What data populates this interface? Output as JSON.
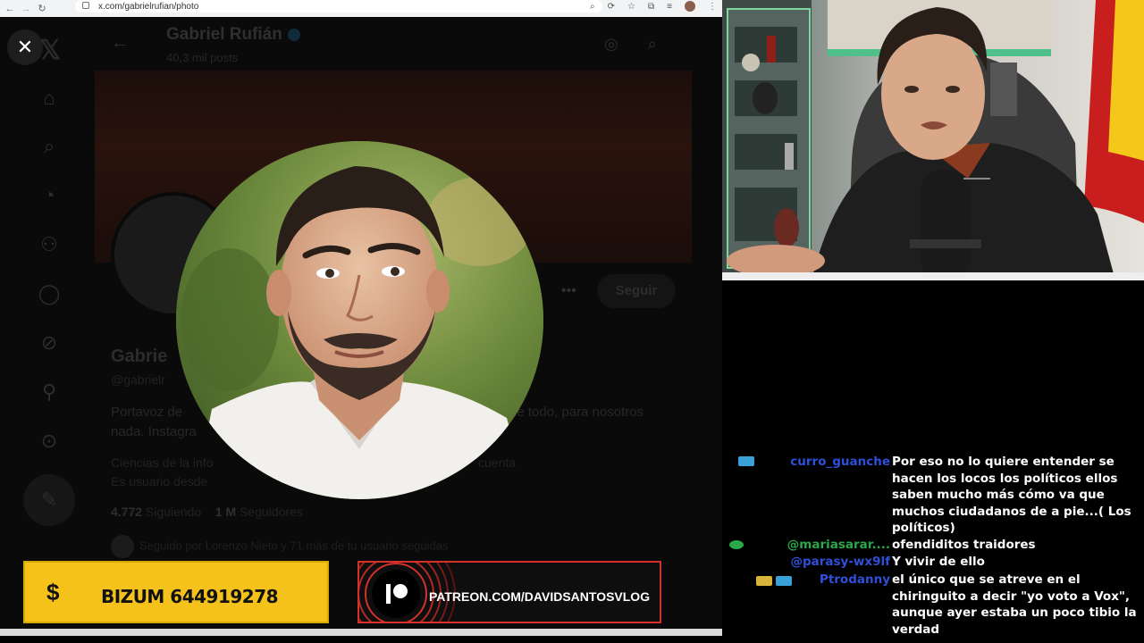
{
  "browser": {
    "url": "x.com/gabrielrufian/photo"
  },
  "x_profile": {
    "top_name": "Gabriel Rufián",
    "posts": "40,3 mil posts",
    "follow_label": "Seguir",
    "display_name": "Gabrie",
    "handle": "@gabrielr",
    "bio_line1": "Portavoz de",
    "bio_line1_right": "de todo, para nosotros",
    "bio_line2": "nada. Instagra",
    "meta_line1": "Ciencias de la info",
    "meta_line1_right": "cuenta",
    "meta_line2": "Es usuario desde",
    "following_count": "4.772",
    "following_label": "Siguiendo",
    "followers_count": "1 M",
    "followers_label": "Seguidores",
    "followed_by": "Seguido por Lorenzo Nieto y 71 más de tu usuario seguidas"
  },
  "modal": {
    "close_icon": "close-icon",
    "close_glyph": "✕"
  },
  "banners": {
    "bizum_symbol": "$",
    "bizum_text": "BIZUM 644919278",
    "patreon_text": "PATREON.COM/DAVIDSANTOSVLOG"
  },
  "chat": {
    "messages": [
      {
        "user": "curro_guanche",
        "user_color": "#2f4fd8",
        "text": "Por eso no lo quiere entender se hacen los locos los políticos ellos saben mucho más cómo va que muchos ciudadanos de a pie...( Los políticos)"
      },
      {
        "user": "@mariasarar....",
        "user_color": "#2aa84a",
        "text": "ofendiditos traidores"
      },
      {
        "user": "@parasy-wx9lf",
        "user_color": "#2f4fd8",
        "text": "Y vivir de ello"
      },
      {
        "user": "Ptrodanny",
        "user_color": "#2f4fd8",
        "text": "el único que se atreve en el chiringuito a decir \"yo voto a Vox\", aunque ayer estaba un poco tibio la verdad"
      }
    ]
  },
  "colors": {
    "bizum_bg": "#f4c21a",
    "patreon_border": "#d3312a",
    "chat_user_blue": "#2f4fd8",
    "chat_user_green": "#2aa84a"
  }
}
